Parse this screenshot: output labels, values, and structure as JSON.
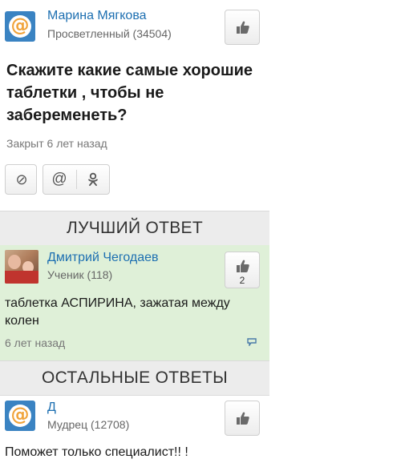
{
  "question_author": {
    "name": "Марина Мягкова",
    "rank": "Просветленный (34504)",
    "avatar_icon": "at-sign-avatar"
  },
  "question": {
    "title": "Скажите какие самые хорошие таблетки , чтобы не забеременеть?",
    "status": "Закрыт 6 лет назад"
  },
  "actions": [
    {
      "icon": "block-icon",
      "glyph": "⊘"
    },
    {
      "icon": "at-icon",
      "glyph": "@"
    },
    {
      "icon": "odnoklassniki-icon",
      "glyph": "ok"
    }
  ],
  "best_answer": {
    "section_title": "ЛУЧШИЙ ОТВЕТ",
    "author": {
      "name": "Дмитрий Чегодаев",
      "rank": "Ученик (118)"
    },
    "likes": "2",
    "text": "таблетка АСПИРИНА, зажатая между колен",
    "time": "6 лет назад"
  },
  "other_answers": {
    "section_title": "ОСТАЛЬНЫЕ ОТВЕТЫ",
    "items": [
      {
        "author": {
          "name": "Д",
          "rank": "Мудрец (12708)"
        },
        "text": "Поможет только специалист!! !"
      }
    ]
  },
  "colors": {
    "link": "#1d6fb1",
    "best_bg": "#dff0d8",
    "avatar_blue": "#3a83c2",
    "at_orange": "#f0a33a"
  }
}
